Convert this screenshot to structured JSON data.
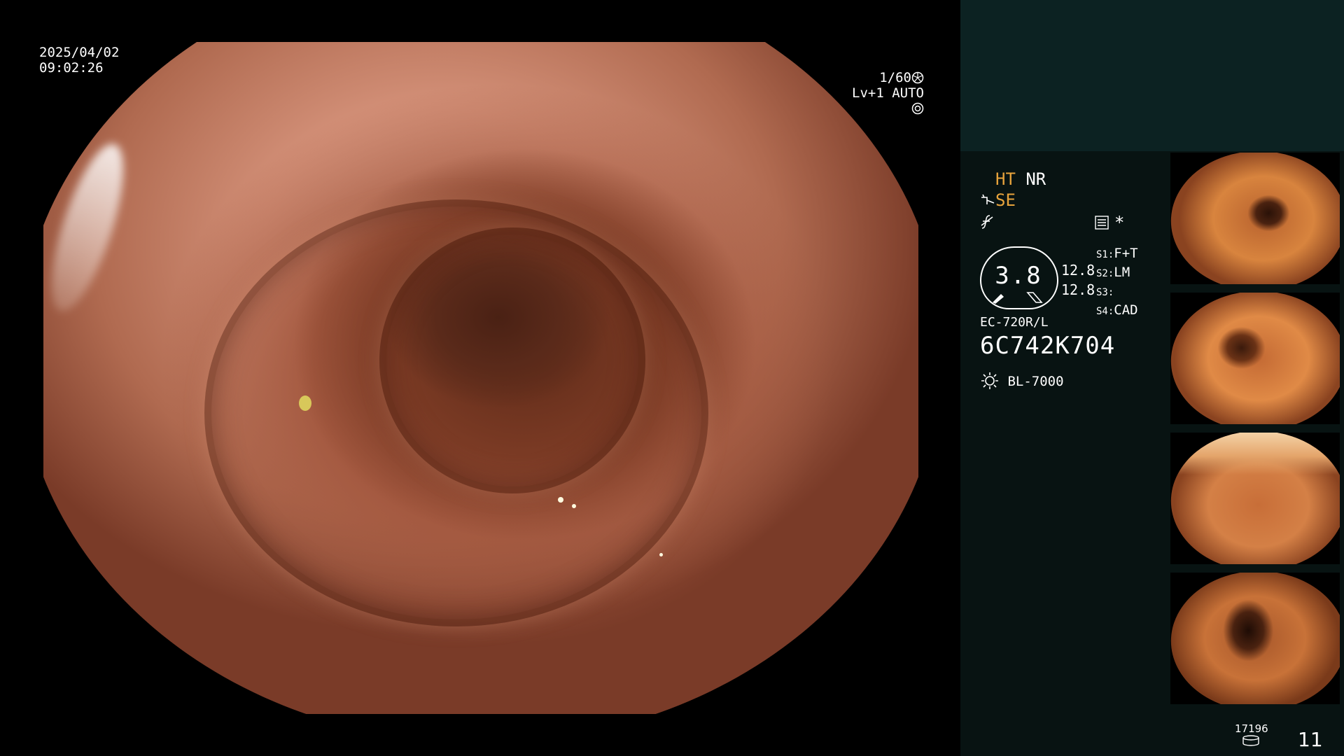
{
  "overlay": {
    "date": "2025/04/02",
    "time": "09:02:26",
    "shutter": "1/60",
    "exposure_level": "Lv+1",
    "exposure_mode": "AUTO"
  },
  "panel": {
    "ht_label": "HT",
    "nr_label": "NR",
    "se_label": "SE",
    "magnification": "3.8",
    "value_upper": "12.8",
    "value_lower": "12.8",
    "scope_model": "EC-720R/L",
    "scope_serial": "6C742K704",
    "light_source": "BL-7000",
    "switches": [
      {
        "key": "S1:",
        "value": "F+T"
      },
      {
        "key": "S2:",
        "value": "LM"
      },
      {
        "key": "S3:",
        "value": ""
      },
      {
        "key": "S4:",
        "value": "CAD"
      }
    ],
    "capture_remaining": "17196",
    "image_count": "11"
  },
  "icons": {
    "shutter": "aperture-icon",
    "auto": "iris-icon",
    "se": "scope-tip-icon",
    "f": "slash-f-icon",
    "settings": "settings-list-icon",
    "star": "asterisk-icon",
    "light": "light-bulb-icon",
    "storage": "storage-disk-icon"
  },
  "colors": {
    "accent_orange": "#e7a33c",
    "panel_top": "#0c2222",
    "panel_bottom": "#081312"
  }
}
